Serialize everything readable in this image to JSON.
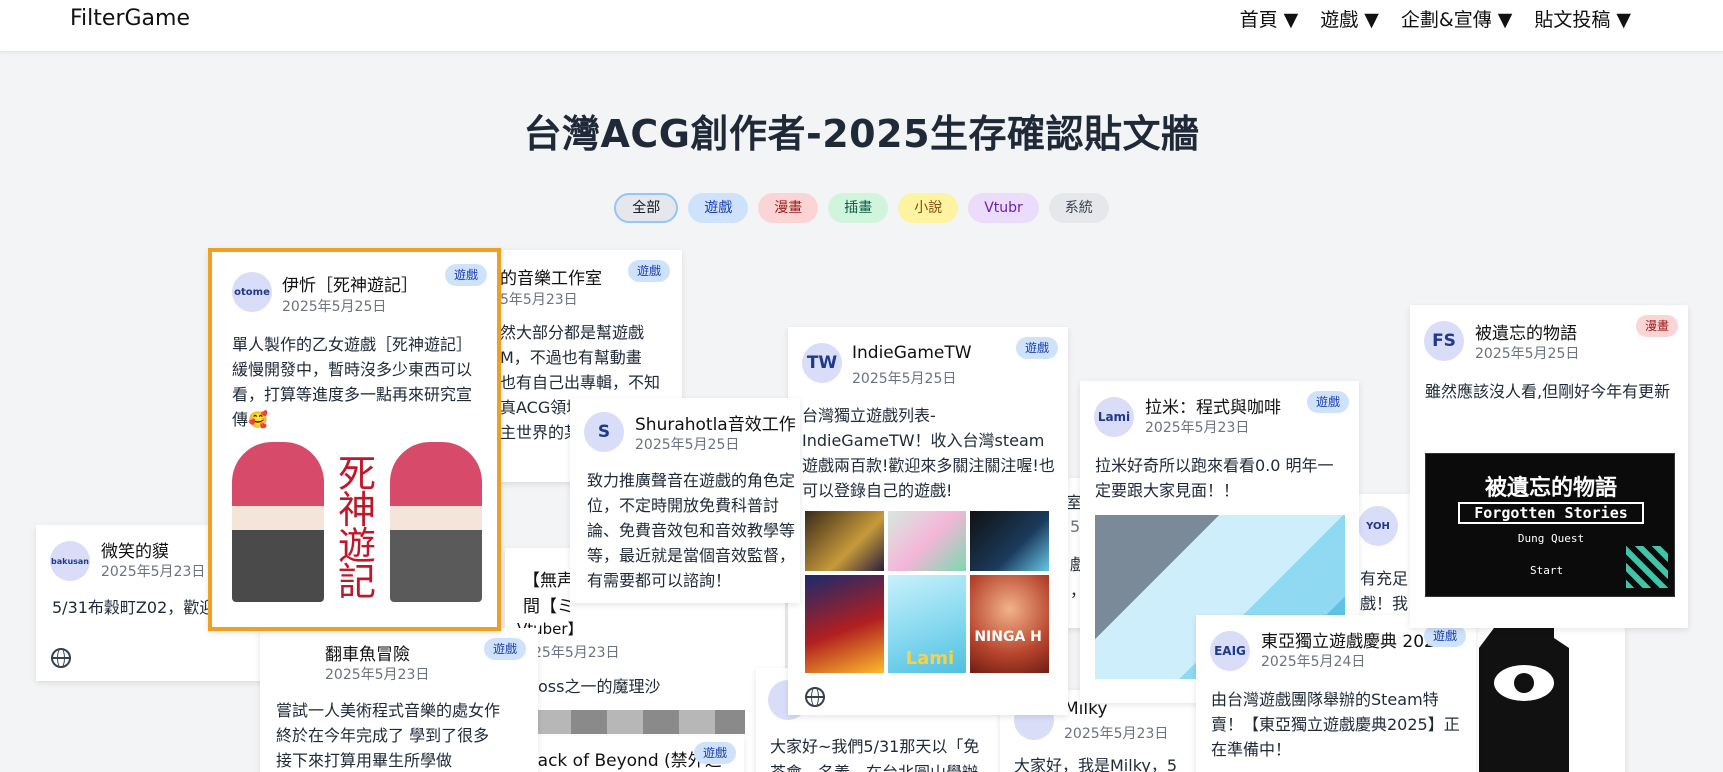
{
  "nav": {
    "brand": "FilterGame",
    "items": [
      {
        "label": "首頁 ▼"
      },
      {
        "label": "遊戲 ▼"
      },
      {
        "label": "企劃&宣傳 ▼"
      },
      {
        "label": "貼文投稿 ▼"
      }
    ]
  },
  "page_title": "台灣ACG創作者-2025生存確認貼文牆",
  "filters": [
    {
      "label": "全部",
      "bg": "#e5e7eb",
      "fg": "#111827",
      "active": true
    },
    {
      "label": "遊戲",
      "bg": "#cfe2fb",
      "fg": "#1e40af"
    },
    {
      "label": "漫畫",
      "bg": "#fbd5d5",
      "fg": "#9b1c1c"
    },
    {
      "label": "插畫",
      "bg": "#d1f5dc",
      "fg": "#065f46"
    },
    {
      "label": "小說",
      "bg": "#fef3a0",
      "fg": "#854d0e"
    },
    {
      "label": "Vtubr",
      "bg": "#ecdcfc",
      "fg": "#6b21a8"
    },
    {
      "label": "系統",
      "bg": "#e5e7eb",
      "fg": "#374151"
    }
  ],
  "colors": {
    "highlight_border": "#f0a020",
    "avatar_bg": "#d9ddf8"
  },
  "cards": {
    "bakusan": {
      "avatar": "bakusan",
      "name": "微笑的貘",
      "date": "2025年5月23日",
      "text": "5/31布穀町Z02，歡迎"
    },
    "music": {
      "name": "的音樂工作室",
      "date": "5年5月23日",
      "tag": "遊戲",
      "lines": [
        "然大部分都是幫遊戲",
        "M，不過也有幫動畫",
        "也有自己出專輯，不知",
        "真ACG領域",
        "主世界的某"
      ]
    },
    "otome": {
      "avatar": "otome",
      "name": "伊忻［死神遊記］",
      "date": "2025年5月25日",
      "tag": "遊戲",
      "text": "單人製作的乙女遊戲［死神遊記］緩慢開發中，暫時沒多少東西可以看，打算等進度多一點再來研究宣傳🥰",
      "art_title": "死神遊記"
    },
    "shurahotla": {
      "avatar": "S",
      "name": "Shurahotla音效工作",
      "date": "2025年5月25日",
      "text": "致力推廣聲音在遊戲的角色定位，不定時開放免費科普討論、免費音效包和音效教學等等，最近就是當個音效監督，有需要都可以諮詢！"
    },
    "indie": {
      "avatar": "TW",
      "name": "IndieGameTW",
      "date": "2025年5月25日",
      "tag": "遊戲",
      "text": "台灣獨立遊戲列表-IndieGameTW！收入台灣steam遊戲兩百款!歡迎來多關注關注喔!也可以登錄自己的遊戲!",
      "thumb_labels": [
        "Lami",
        "NINGA H"
      ]
    },
    "lami": {
      "avatar": "Lami",
      "name": "拉米：程式與咖啡",
      "date": "2025年5月23日",
      "tag": "遊戲",
      "text": "拉米好奇所以跑來看看0.0 明年一定要跟大家見面！！"
    },
    "forgotten": {
      "avatar": "FS",
      "name": "被遺忘的物語",
      "date": "2025年5月25日",
      "tag": "漫畫",
      "text": "雖然應該沒人看,但剛好今年有更新",
      "art_title_1": "被遺忘的物語",
      "art_title_2": "Forgotten Stories",
      "art_sub": "Dung Quest",
      "art_start": "Start"
    },
    "capsize": {
      "name": "翻車魚冒險",
      "date": "2025年5月23日",
      "tag": "遊戲",
      "lines": [
        "嘗試一人美術程式音樂的處女作",
        "終於在今年完成了 學到了很多",
        "接下來打算用畢生所學做"
      ]
    },
    "vtuber": {
      "name": "【無声",
      "name2": "間【ミ",
      "name3": "Vtuber】",
      "date": "25年5月23日",
      "text": "oss之一的魔理沙"
    },
    "beyond": {
      "name": "Back of Beyond (禁外之",
      "tag": "遊戲"
    },
    "milky": {
      "name": "Milky",
      "date": "2025年5月23日",
      "text": "大家好，我是Milky，5"
    },
    "visit": {
      "text": "大家好~我們5/31那天以「免",
      "text2": "茶會，名義，在台北圓山學辦"
    },
    "eaig": {
      "avatar": "EAIG",
      "name": "東亞獨立遊戲慶典 2025",
      "date": "2025年5月24日",
      "tag": "遊戲",
      "text": "由台灣遊戲團隊舉辦的Steam特賣！【東亞獨立遊戲慶典2025】正在準備中！"
    },
    "yoh": {
      "avatar": "YOH",
      "text": "有充足",
      "text2": "戲！我"
    },
    "partial_a": {
      "text": "室",
      "text2": "戲",
      "text3": "5",
      "text4": "，啦"
    }
  }
}
